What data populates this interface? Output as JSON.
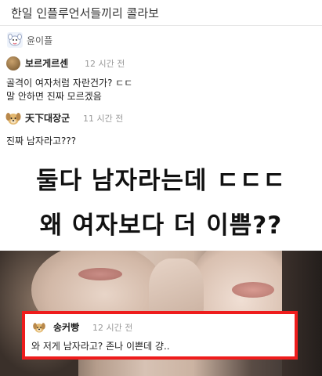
{
  "page": {
    "title": "한일 인플루언서들끼리 콜라보"
  },
  "author": {
    "name": "윤이플",
    "icon": "dog-sticker-icon"
  },
  "comments": [
    {
      "name": "보르게르센",
      "time": "12 시간 전",
      "lines": [
        "골격이 여자처럼 자란건가? ㄷㄷ",
        "말 안하면 진짜 모르겠음"
      ],
      "avatar": "brown-circle-avatar"
    },
    {
      "name": "天下대장군",
      "time": "11 시간 전",
      "lines": [
        "진짜 남자라고???"
      ],
      "avatar": "dog-avatar"
    }
  ],
  "headline": {
    "line1": "둘다 남자라는데 ㄷㄷㄷ",
    "line2": "왜 여자보다 더 이쁨??"
  },
  "featured_comment": {
    "name": "송커빵",
    "time": "12 시간 전",
    "text": "와 저게 남자라고? 존나 이쁜데 걍..",
    "avatar": "dog-avatar",
    "border_color": "#ee1c1c"
  }
}
